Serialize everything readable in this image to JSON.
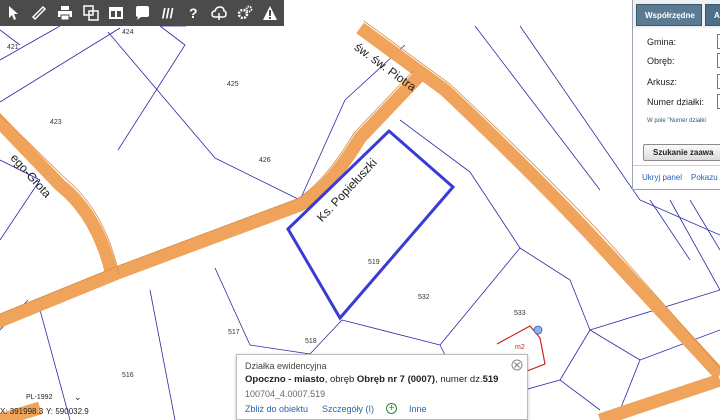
{
  "toolbar": {
    "tools": [
      {
        "name": "select-tool",
        "icon": "pointer-icon"
      },
      {
        "name": "measure-tool",
        "icon": "ruler-icon"
      },
      {
        "name": "print-tool",
        "icon": "printer-icon"
      },
      {
        "name": "layers-tool",
        "icon": "layers-icon"
      },
      {
        "name": "layout-tool",
        "icon": "window-icon"
      },
      {
        "name": "comment-tool",
        "icon": "speech-bubble-icon"
      },
      {
        "name": "lines-tool",
        "glyph": "///"
      },
      {
        "name": "help-tool",
        "glyph": "?"
      },
      {
        "name": "cloud-tool",
        "icon": "cloud-icon"
      },
      {
        "name": "settings-tool",
        "icon": "gear-icon"
      },
      {
        "name": "warning-tool",
        "icon": "warning-icon"
      }
    ]
  },
  "map": {
    "parcels": [
      "421",
      "424",
      "423",
      "425",
      "426",
      "519",
      "532",
      "533",
      "517",
      "518",
      "516",
      "531",
      "533"
    ],
    "streets": [
      "św. św. Piotra",
      "Ks. Popiełuszki",
      "ego-Grota"
    ],
    "building_label": "m2",
    "colors": {
      "road": "#f0a35a",
      "parcel_line": "#2a2aa8",
      "selected_parcel": "#3a3ad6",
      "building": "#cc2222"
    }
  },
  "panel": {
    "tabs": [
      "Współrzędne",
      "Adres"
    ],
    "gmina_label": "Gmina:",
    "obreb_label": "Obręb:",
    "arkusz_label": "Arkusz:",
    "numer_label": "Numer działki:",
    "numer_value": "5",
    "hint": "W pole \"Numer działki",
    "search_button": "Szukanie zaawa",
    "hide_link": "Ukryj panel",
    "show_link": "Pokazu"
  },
  "popup": {
    "title": "Działka ewidencyjna",
    "place": "Opoczno - miasto",
    "obreb_text": ", obręb ",
    "obreb_value": "Obręb nr 7 (0007)",
    "numer_text": ", numer dz.",
    "numer_value": "519",
    "id": "100704_4.0007.519",
    "zoom_link": "Zbliż do obiektu",
    "details_link": "Szczegóły (I)",
    "other_link": "Inne"
  },
  "coords": {
    "crs": "PL-1992",
    "x": "X: 391998.3",
    "y": "Y: 590032.9"
  }
}
